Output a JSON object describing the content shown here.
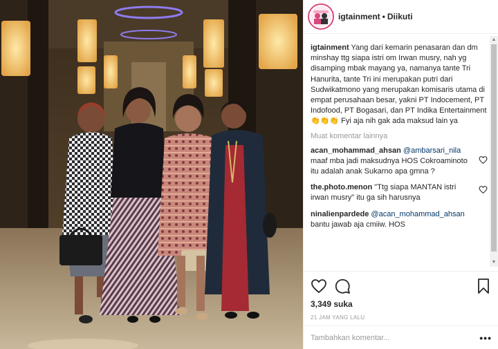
{
  "header": {
    "username": "igtainment",
    "separator": "•",
    "follow_status": "Diikuti"
  },
  "caption": {
    "username": "igtainment",
    "text": "Yang dari kemarin penasaran dan dm minshay ttg siapa istri om Irwan musry, nah yg disamping mbak mayang ya, namanya tante Tri Hanurita, tante Tri ini merupakan putri dari Sudwikatmono yang merupakan komisaris utama di empat perusahaan besar, yakni PT Indocement, PT Indofood, PT Bogasari, dan PT Indika Entertainment 👏👏👏 Fyi aja nih gak ada maksud lain ya"
  },
  "load_more": "Muat komentar lainnya",
  "comments": [
    {
      "username": "acan_mohammad_ahsan",
      "mention": "@ambarsari_nila",
      "text": " maaf mba jadi maksudnya HOS Cokroaminoto itu adalah anak Sukarno apa gmna ?"
    },
    {
      "username": "the.photo.menon",
      "mention": "",
      "text": "\"Ttg siapa MANTAN istri irwan musry\" itu ga sih harusnya"
    },
    {
      "username": "ninalienpardede",
      "mention": "@acan_mohammad_ahsan",
      "text": " bantu jawab aja cmiiw. HOS"
    }
  ],
  "likes": "3,349 suka",
  "timestamp": "21 JAM YANG LALU",
  "add_comment_placeholder": "Tambahkan komentar...",
  "options_label": "•••",
  "icons": {
    "like": "heart-icon",
    "comment": "comment-bubble-icon",
    "save": "bookmark-icon",
    "comment_like": "heart-small-icon"
  }
}
